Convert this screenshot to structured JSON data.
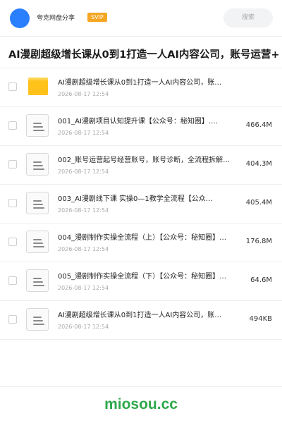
{
  "header": {
    "app_name": "夸克网盘分享",
    "badge": "SVIP",
    "search_placeholder": "搜索"
  },
  "title": "AI漫剧超级增长课从0到1打造一人AI内容公司，账号运营+",
  "files": [
    {
      "type": "folder",
      "name": "AI漫剧超级增长课从0到1打造一人AI内容公司，账…",
      "date": "2026-08-17 12:54",
      "size": ""
    },
    {
      "type": "file",
      "name": "001_AI漫剧项目认知提升课【公众号：秘知圈】.…",
      "date": "2026-08-17 12:54",
      "size": "466.4M"
    },
    {
      "type": "file",
      "name": "002_账号运营起号经营账号，账号诊断，全流程拆解…",
      "date": "2026-08-17 12:54",
      "size": "404.3M"
    },
    {
      "type": "file",
      "name": "003_AI漫剧线下课 实操0—1教学全流程【公众…",
      "date": "2026-08-17 12:54",
      "size": "405.4M"
    },
    {
      "type": "file",
      "name": "004_漫剧制作实操全流程（上）【公众号：秘知圈】…",
      "date": "2026-08-17 12:54",
      "size": "176.8M"
    },
    {
      "type": "file",
      "name": "005_漫剧制作实操全流程（下）【公众号：秘知圈】…",
      "date": "2026-08-17 12:54",
      "size": "64.6M"
    },
    {
      "type": "file",
      "name": "AI漫剧超级增长课从0到1打造一人AI内容公司，账…",
      "date": "2026-08-17 12:54",
      "size": "494KB"
    }
  ],
  "footer": {
    "brand": "miosou.cc"
  },
  "colors": {
    "accent": "#2a7fff",
    "svip": "#f5a623",
    "folder": "#ffc21a",
    "brand": "#2ea84a"
  },
  "icons": [
    "avatar",
    "folder-icon",
    "document-icon",
    "checkbox"
  ]
}
